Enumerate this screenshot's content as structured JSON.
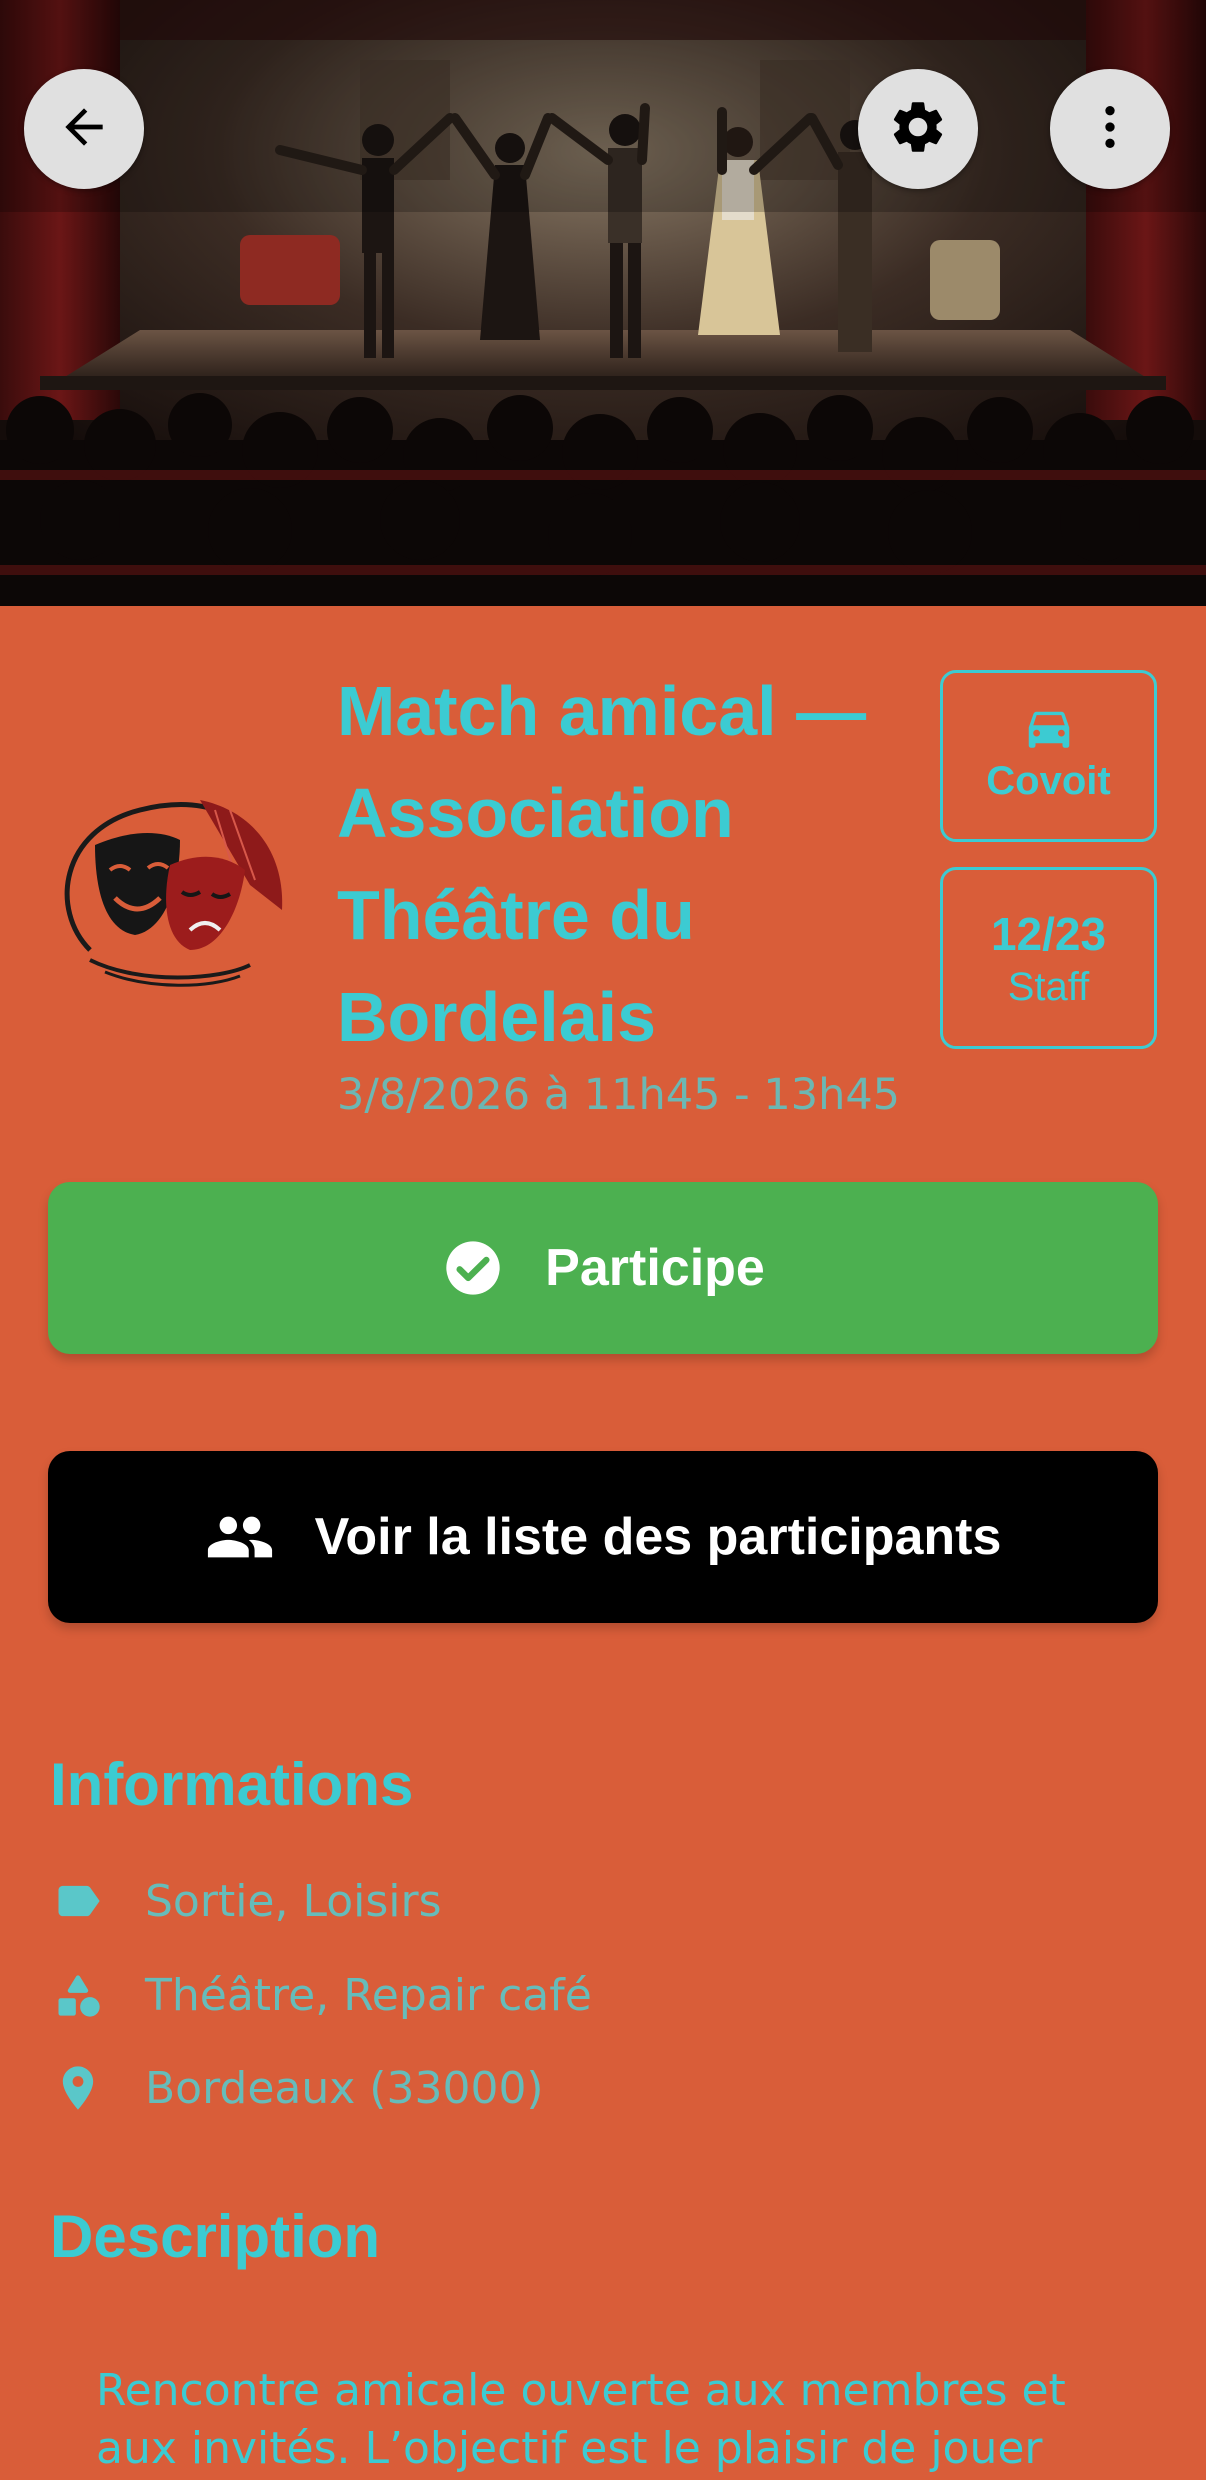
{
  "header": {
    "back_icon": "arrow-left-icon",
    "settings_icon": "gear-icon",
    "more_icon": "more-vertical-icon",
    "hero_image": "theatre-curtain-call-photo"
  },
  "event": {
    "title": "Match amical — Association Théâtre du Bordelais",
    "datetime": "3/8/2026 à 11h45 - 13h45",
    "logo_icon": "theatre-masks-logo"
  },
  "chips": {
    "covoit_label": "Covoit",
    "covoit_icon": "car-icon",
    "staff_count": "12/23",
    "staff_label": "Staff"
  },
  "actions": {
    "participate_label": "Participe",
    "participate_icon": "check-circle-icon",
    "participants_label": "Voir la liste des participants",
    "participants_icon": "group-icon"
  },
  "informations": {
    "title": "Informations",
    "categories": "Sortie, Loisirs",
    "categories_icon": "tag-icon",
    "activities": "Théâtre, Repair café",
    "activities_icon": "shapes-icon",
    "location": "Bordeaux (33000)",
    "location_icon": "location-pin-icon"
  },
  "description": {
    "title": "Description",
    "text": "Rencontre amicale ouverte aux membres et aux invités. L’objectif est le plaisir de jouer"
  },
  "colors": {
    "background": "#D95D39",
    "accent": "#3CCBD2",
    "participate": "#4CB050",
    "list_button": "#000000"
  }
}
